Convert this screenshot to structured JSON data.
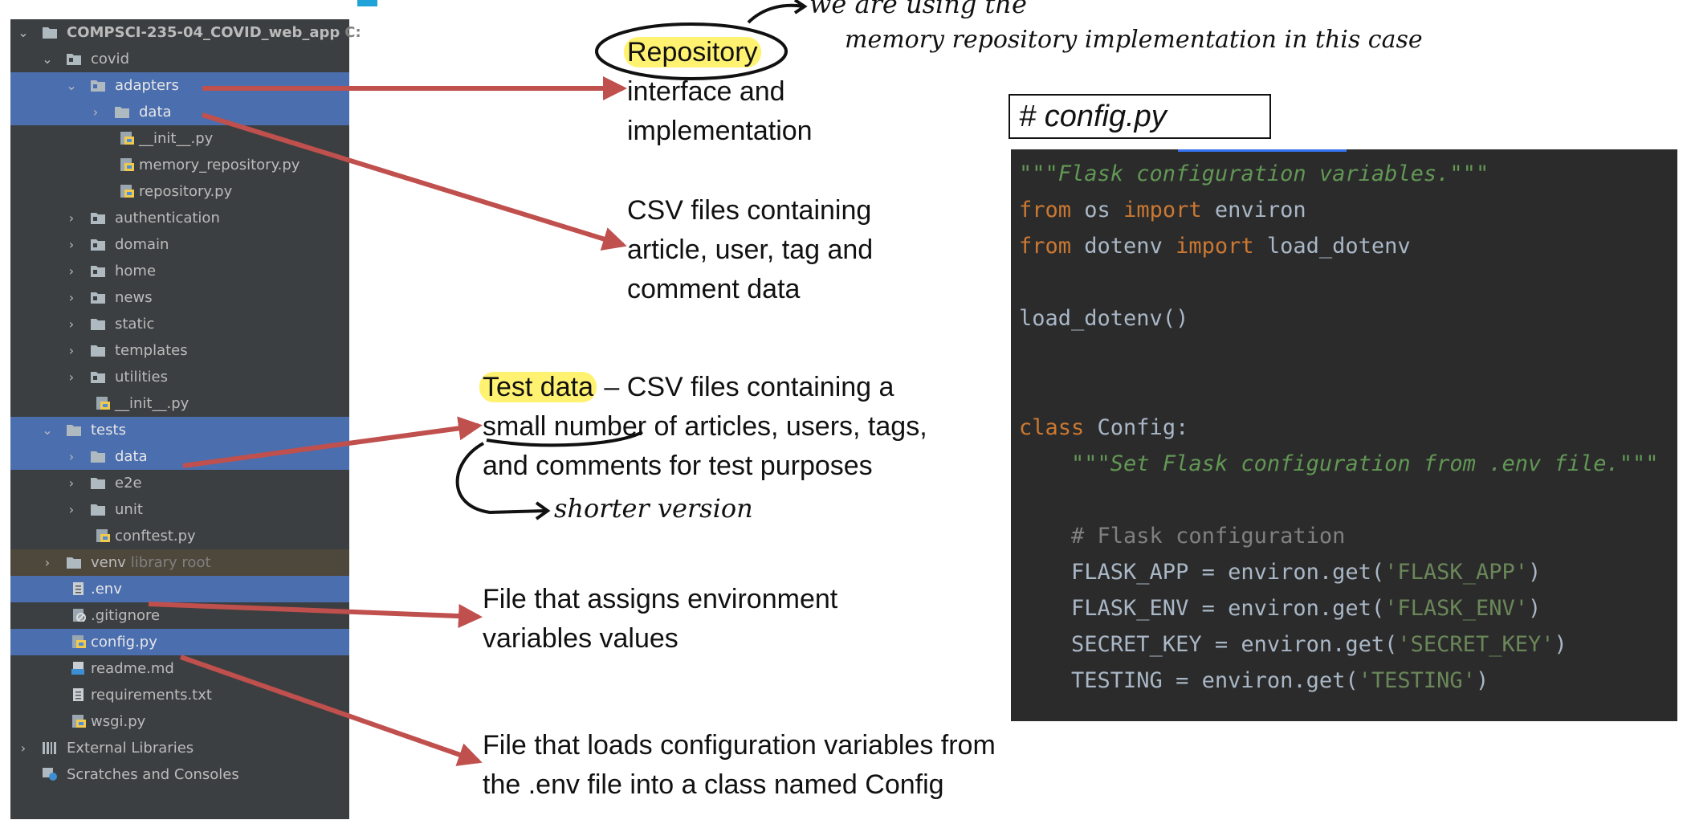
{
  "tree": {
    "root": {
      "label": "COMPSCI-235-04_COVID_web_app",
      "hint": "C:"
    },
    "items": [
      {
        "label": "covid"
      },
      {
        "label": "adapters"
      },
      {
        "label": "data"
      },
      {
        "label": "__init__.py"
      },
      {
        "label": "memory_repository.py"
      },
      {
        "label": "repository.py"
      },
      {
        "label": "authentication"
      },
      {
        "label": "domain"
      },
      {
        "label": "home"
      },
      {
        "label": "news"
      },
      {
        "label": "static"
      },
      {
        "label": "templates"
      },
      {
        "label": "utilities"
      },
      {
        "label": "__init__.py"
      },
      {
        "label": "tests"
      },
      {
        "label": "data"
      },
      {
        "label": "e2e"
      },
      {
        "label": "unit"
      },
      {
        "label": "conftest.py"
      },
      {
        "label": "venv",
        "hint": "library root"
      },
      {
        "label": ".env"
      },
      {
        "label": ".gitignore"
      },
      {
        "label": "config.py"
      },
      {
        "label": "readme.md"
      },
      {
        "label": "requirements.txt"
      },
      {
        "label": "wsgi.py"
      },
      {
        "label": "External Libraries"
      },
      {
        "label": "Scratches and Consoles"
      }
    ]
  },
  "notes": {
    "repository": {
      "highlight": "Repository",
      "line1_rest": "",
      "line2": "interface and",
      "line3": "implementation"
    },
    "csv": {
      "line1": "CSV files containing",
      "line2": "article, user, tag and",
      "line3": "comment data"
    },
    "testdata": {
      "highlight": "Test data",
      "line1_rest": " – CSV files containing a",
      "line2": "small number of articles, users, tags,",
      "line3": "and  comments for test purposes"
    },
    "env": {
      "line1": "File that assigns environment",
      "line2": "variables values"
    },
    "config": {
      "line1": "File that loads configuration variables from",
      "line2": "the .env file into a class named Config"
    },
    "config_box": "# config.py"
  },
  "handwriting": {
    "line1": "we are using the",
    "line2": "memory repository implementation in this case",
    "shorter": "shorter version"
  },
  "code": {
    "l1": "\"\"\"Flask configuration variables.\"\"\"",
    "l2_kw1": "from",
    "l2_a": " os ",
    "l2_kw2": "import",
    "l2_b": " environ",
    "l3_kw1": "from",
    "l3_a": " dotenv ",
    "l3_kw2": "import",
    "l3_b": " load_dotenv",
    "l4": "load_dotenv()",
    "l5_kw": "class",
    "l5_rest": " Config:",
    "l6": "    \"\"\"Set Flask configuration from .env file.\"\"\"",
    "l7": "    # Flask configuration",
    "l8_a": "    FLASK_APP = environ.get(",
    "l8_s": "'FLASK_APP'",
    "l8_b": ")",
    "l9_a": "    FLASK_ENV = environ.get(",
    "l9_s": "'FLASK_ENV'",
    "l9_b": ")",
    "l10_a": "    SECRET_KEY = environ.get(",
    "l10_s": "'SECRET_KEY'",
    "l10_b": ")",
    "l11_a": "    TESTING = environ.get(",
    "l11_s": "'TESTING'",
    "l11_b": ")"
  },
  "colors": {
    "selection": "#4b6eaf",
    "panel": "#3c3f41",
    "arrow": "#c0504d",
    "highlight": "#fff271"
  }
}
